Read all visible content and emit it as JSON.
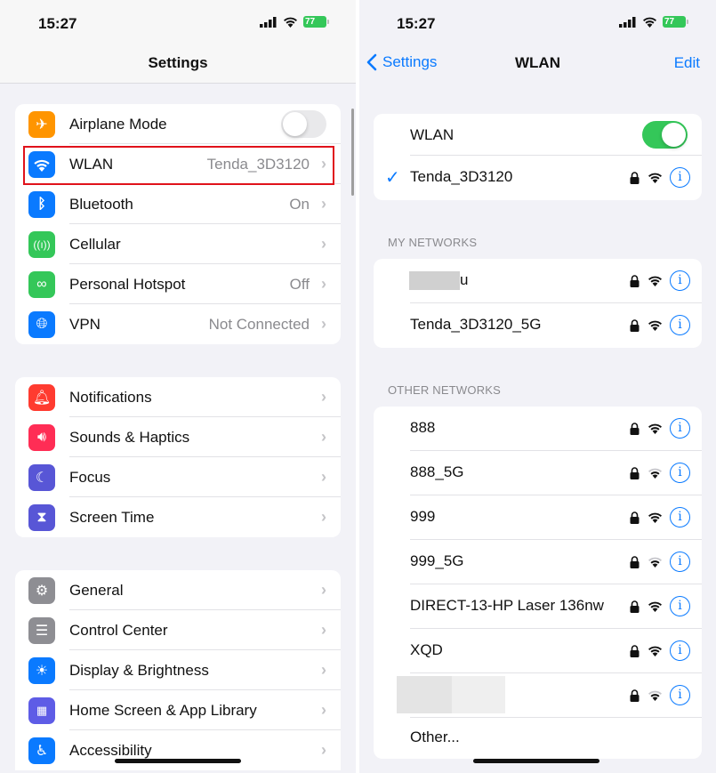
{
  "left": {
    "status": {
      "time": "15:27",
      "battery": "77"
    },
    "title": "Settings",
    "groups": [
      [
        {
          "label": "Airplane Mode",
          "icon": "airplane-icon",
          "color": "#ff9500",
          "toggle": false
        },
        {
          "label": "WLAN",
          "icon": "wifi-icon",
          "color": "#0a7aff",
          "value": "Tenda_3D3120"
        },
        {
          "label": "Bluetooth",
          "icon": "bluetooth-icon",
          "color": "#0a7aff",
          "value": "On"
        },
        {
          "label": "Cellular",
          "icon": "cellular-icon",
          "color": "#34c759",
          "value": ""
        },
        {
          "label": "Personal Hotspot",
          "icon": "hotspot-icon",
          "color": "#34c759",
          "value": "Off"
        },
        {
          "label": "VPN",
          "icon": "vpn-globe-icon",
          "color": "#0a7aff",
          "value": "Not Connected"
        }
      ],
      [
        {
          "label": "Notifications",
          "icon": "bell-icon",
          "color": "#ff3b30"
        },
        {
          "label": "Sounds & Haptics",
          "icon": "speaker-icon",
          "color": "#ff2d55"
        },
        {
          "label": "Focus",
          "icon": "moon-icon",
          "color": "#5856d6"
        },
        {
          "label": "Screen Time",
          "icon": "hourglass-icon",
          "color": "#5856d6"
        }
      ],
      [
        {
          "label": "General",
          "icon": "gear-icon",
          "color": "#8e8e93"
        },
        {
          "label": "Control Center",
          "icon": "switches-icon",
          "color": "#8e8e93"
        },
        {
          "label": "Display & Brightness",
          "icon": "sun-icon",
          "color": "#0a7aff"
        },
        {
          "label": "Home Screen & App Library",
          "icon": "app-grid-icon",
          "color": "#5e5ce6"
        },
        {
          "label": "Accessibility",
          "icon": "accessibility-icon",
          "color": "#0a7aff"
        }
      ]
    ]
  },
  "right": {
    "status": {
      "time": "15:27",
      "battery": "77"
    },
    "back_label": "Settings",
    "title": "WLAN",
    "edit_label": "Edit",
    "wlan_label": "WLAN",
    "wlan_on": true,
    "connected": {
      "name": "Tenda_3D3120",
      "locked": true,
      "signal": 3
    },
    "my_networks_header": "MY NETWORKS",
    "my_networks": [
      {
        "name": "u",
        "redacted": true,
        "locked": true,
        "signal": 3
      },
      {
        "name": "Tenda_3D3120_5G",
        "locked": true,
        "signal": 3
      }
    ],
    "other_networks_header": "OTHER NETWORKS",
    "other_networks": [
      {
        "name": "888",
        "locked": true,
        "signal": 3
      },
      {
        "name": "888_5G",
        "locked": true,
        "signal": 2
      },
      {
        "name": "999",
        "locked": true,
        "signal": 3
      },
      {
        "name": "999_5G",
        "locked": true,
        "signal": 2
      },
      {
        "name": "DIRECT-13-HP Laser 136nw",
        "locked": true,
        "signal": 3
      },
      {
        "name": "XQD",
        "locked": true,
        "signal": 3
      },
      {
        "name": "",
        "redacted": true,
        "locked": true,
        "signal": 2
      }
    ],
    "other_label": "Other..."
  }
}
